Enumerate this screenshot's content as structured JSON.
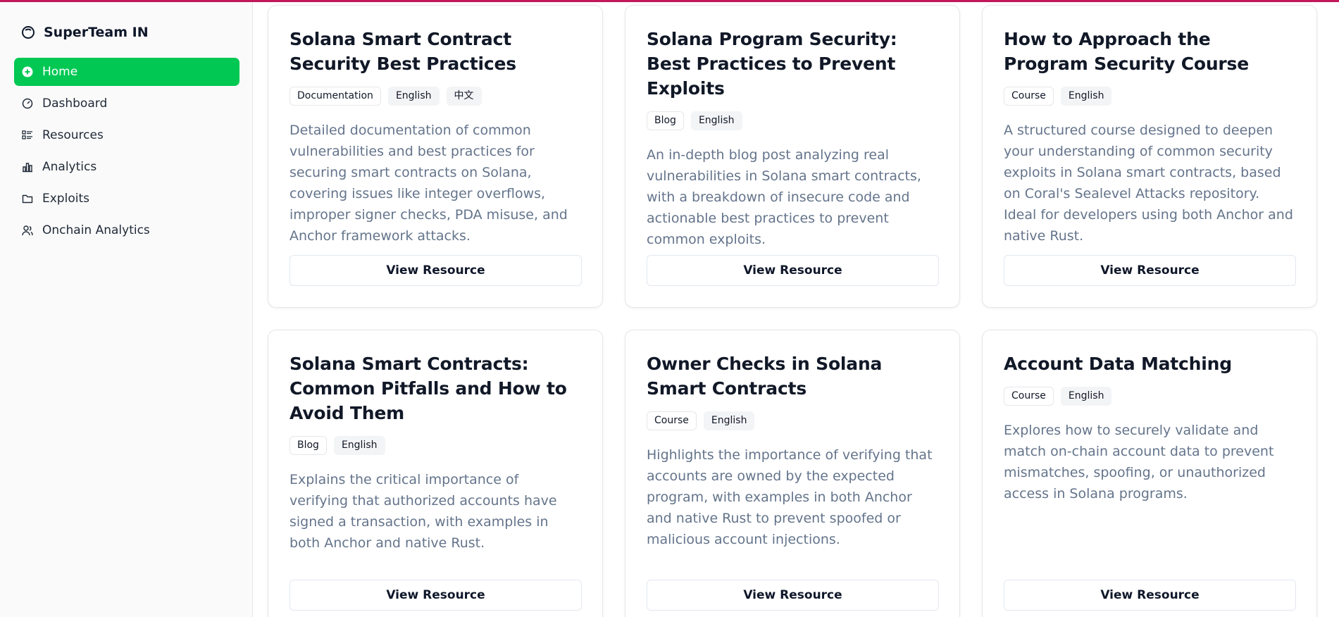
{
  "brand": {
    "name": "SuperTeam IN"
  },
  "nav": [
    {
      "label": "Home",
      "icon": "plus-circle-icon"
    },
    {
      "label": "Dashboard",
      "icon": "gauge-icon"
    },
    {
      "label": "Resources",
      "icon": "list-icon"
    },
    {
      "label": "Analytics",
      "icon": "bar-chart-icon"
    },
    {
      "label": "Exploits",
      "icon": "folder-icon"
    },
    {
      "label": "Onchain Analytics",
      "icon": "users-icon"
    }
  ],
  "cards": [
    {
      "title": "Solana Smart Contract Security Best Practices",
      "tags": [
        "Documentation",
        "English",
        "中文"
      ],
      "description": "Detailed documentation of common vulnerabilities and best practices for securing smart contracts on Solana, covering issues like integer overflows, improper signer checks, PDA misuse, and Anchor framework attacks.",
      "button": "View Resource"
    },
    {
      "title": "Solana Program Security: Best Practices to Prevent Exploits",
      "tags": [
        "Blog",
        "English"
      ],
      "description": "An in-depth blog post analyzing real vulnerabilities in Solana smart contracts, with a breakdown of insecure code and actionable best practices to prevent common exploits.",
      "button": "View Resource"
    },
    {
      "title": "How to Approach the Program Security Course",
      "tags": [
        "Course",
        "English"
      ],
      "description": "A structured course designed to deepen your understanding of common security exploits in Solana smart contracts, based on Coral's Sealevel Attacks repository. Ideal for developers using both Anchor and native Rust.",
      "button": "View Resource"
    },
    {
      "title": "Solana Smart Contracts: Common Pitfalls and How to Avoid Them",
      "tags": [
        "Blog",
        "English"
      ],
      "description": "Explains the critical importance of verifying that authorized accounts have signed a transaction, with examples in both Anchor and native Rust.",
      "button": "View Resource"
    },
    {
      "title": "Owner Checks in Solana Smart Contracts",
      "tags": [
        "Course",
        "English"
      ],
      "description": "Highlights the importance of verifying that accounts are owned by the expected program, with examples in both Anchor and native Rust to prevent spoofed or malicious account injections.",
      "button": "View Resource"
    },
    {
      "title": "Account Data Matching",
      "tags": [
        "Course",
        "English"
      ],
      "description": "Explores how to securely validate and match on-chain account data to prevent mismatches, spoofing, or unauthorized access in Solana programs.",
      "button": "View Resource"
    }
  ],
  "colors": {
    "accent": "#00c853",
    "topline": "#c2185b"
  }
}
